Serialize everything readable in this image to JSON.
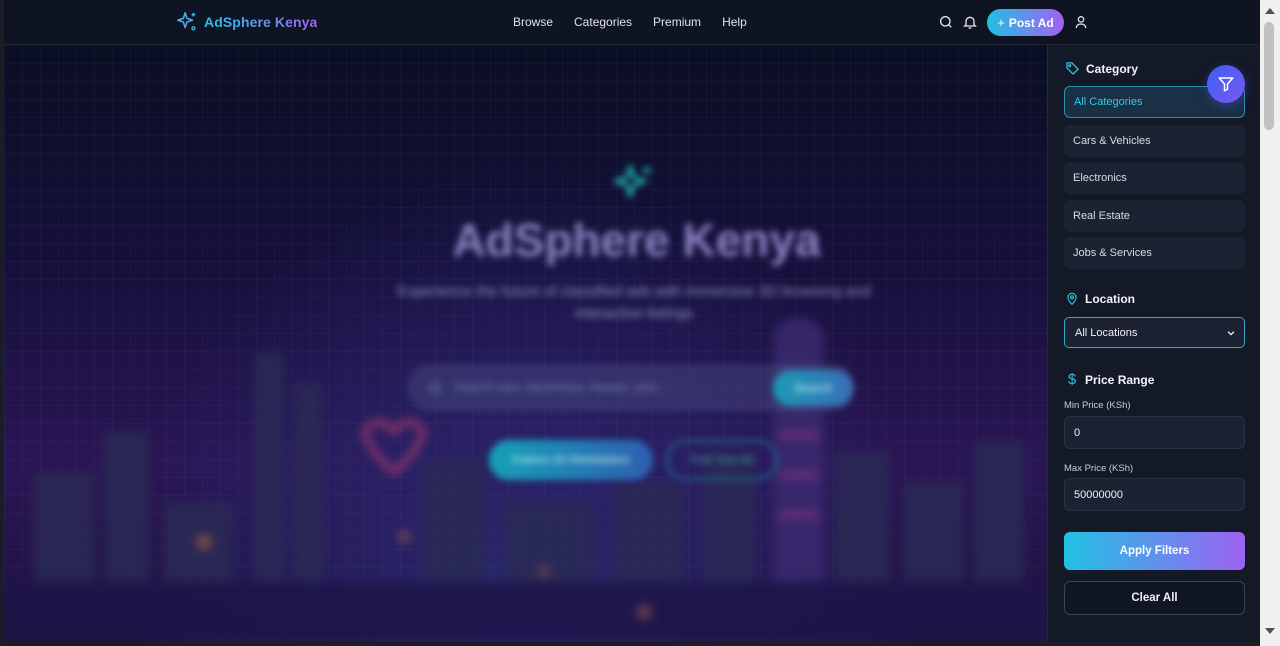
{
  "header": {
    "brand": "AdSphere Kenya",
    "nav": [
      "Browse",
      "Categories",
      "Premium",
      "Help"
    ],
    "post_ad_label": "Post Ad",
    "icons": [
      "search-icon",
      "bell-icon",
      "user-icon"
    ]
  },
  "hero": {
    "title": "AdSphere Kenya",
    "subtitle": "Experience the future of classified ads with immersive 3D browsing and interactive listings",
    "search_placeholder": "Search cars, electronics, houses, jobs...",
    "search_button": "Search",
    "cta_primary": "Explore 3D Marketplace",
    "cta_secondary": "Post Your Ad"
  },
  "filters": {
    "category": {
      "title": "Category",
      "items": [
        "All Categories",
        "Cars & Vehicles",
        "Electronics",
        "Real Estate",
        "Jobs & Services"
      ],
      "selected": "All Categories"
    },
    "location": {
      "title": "Location",
      "selected": "All Locations"
    },
    "price": {
      "title": "Price Range",
      "min_label": "Min Price (KSh)",
      "min_value": "0",
      "max_label": "Max Price (KSh)",
      "max_value": "50000000"
    },
    "apply_label": "Apply Filters",
    "clear_label": "Clear All"
  },
  "colors": {
    "accent_cyan": "#22c6e6",
    "accent_purple": "#a067f5",
    "panel_bg": "#141927",
    "page_bg": "#0b0f1d"
  }
}
